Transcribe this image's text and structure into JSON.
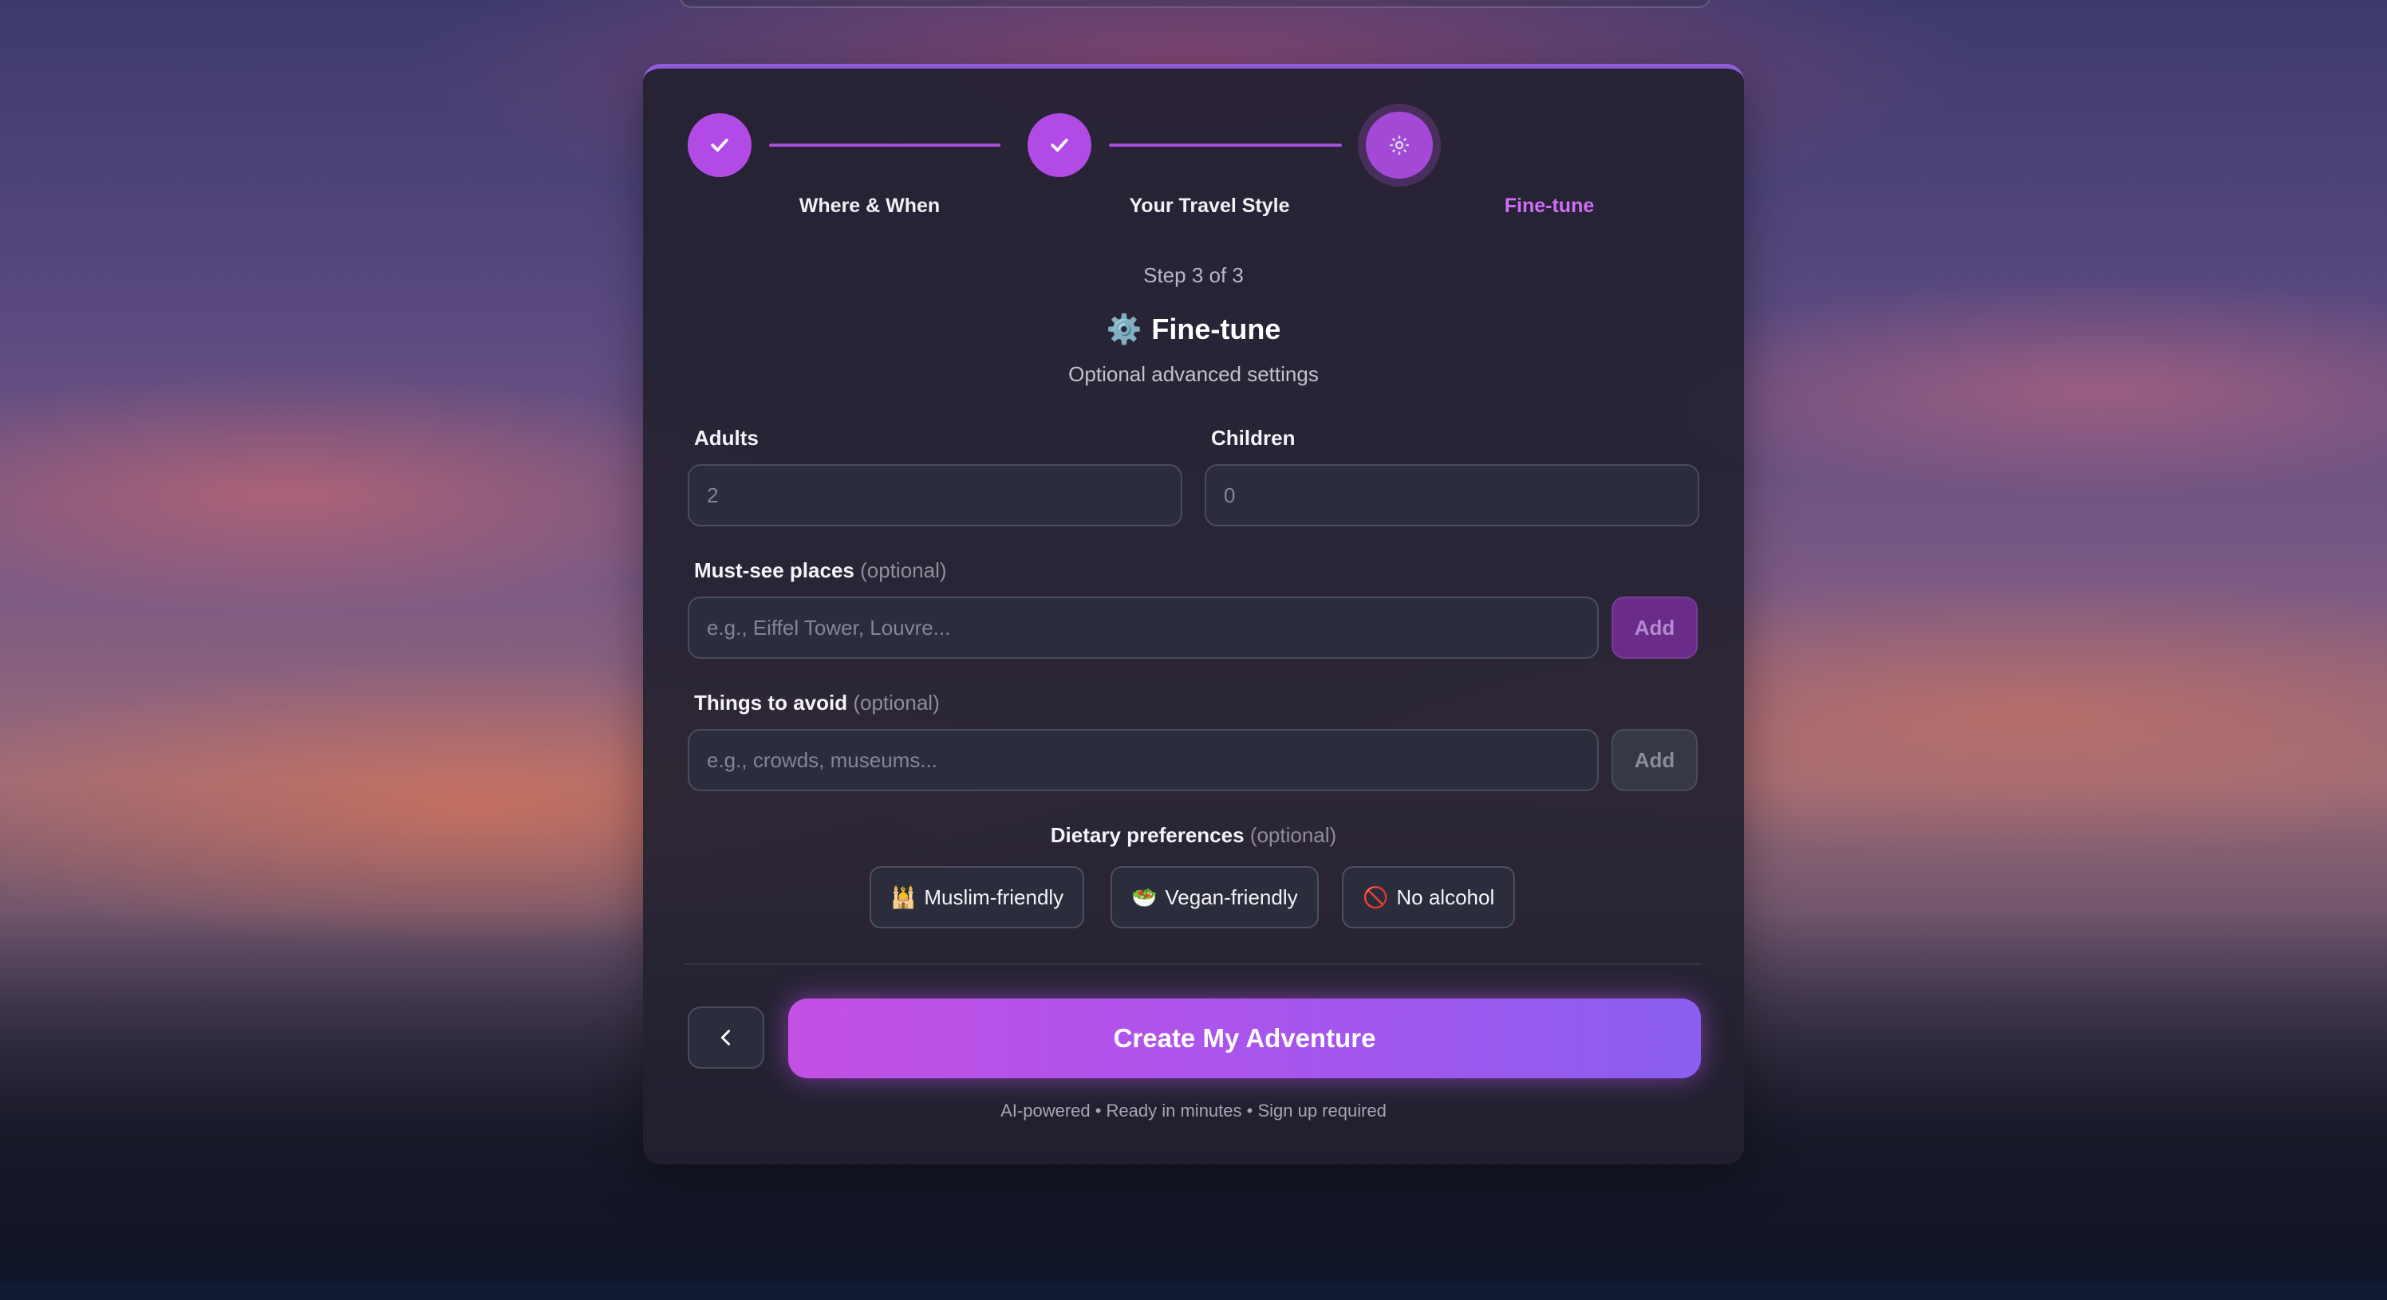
{
  "stepper": {
    "steps": [
      {
        "label": "Where & When",
        "status": "complete",
        "icon": "check-icon"
      },
      {
        "label": "Your Travel Style",
        "status": "complete",
        "icon": "check-icon"
      },
      {
        "label": "Fine-tune",
        "status": "active",
        "icon": "gear-icon"
      }
    ],
    "progress_text": "Step 3 of 3"
  },
  "section": {
    "icon": "⚙️",
    "title": "Fine-tune",
    "subtitle": "Optional advanced settings"
  },
  "form": {
    "adults": {
      "label": "Adults",
      "placeholder": "2"
    },
    "children": {
      "label": "Children",
      "placeholder": "0"
    },
    "must_see": {
      "label": "Must-see places",
      "optional": "(optional)",
      "placeholder": "e.g., Eiffel Tower, Louvre...",
      "button": "Add"
    },
    "avoid": {
      "label": "Things to avoid",
      "optional": "(optional)",
      "placeholder": "e.g., crowds, museums...",
      "button": "Add"
    },
    "dietary": {
      "label": "Dietary preferences",
      "optional": "(optional)",
      "options": [
        {
          "emoji": "🕌",
          "label": "Muslim-friendly"
        },
        {
          "emoji": "🥗",
          "label": "Vegan-friendly"
        },
        {
          "emoji": "🚫",
          "label": "No alcohol"
        }
      ]
    }
  },
  "actions": {
    "back_icon": "chevron-left-icon",
    "submit_label": "Create My Adventure",
    "footnote": "AI-powered • Ready in minutes • Sign up required"
  },
  "colors": {
    "accent": "#b24be6",
    "active_label": "#d06ef5",
    "cta_start": "#c450e6",
    "cta_end": "#8a5ef0"
  }
}
